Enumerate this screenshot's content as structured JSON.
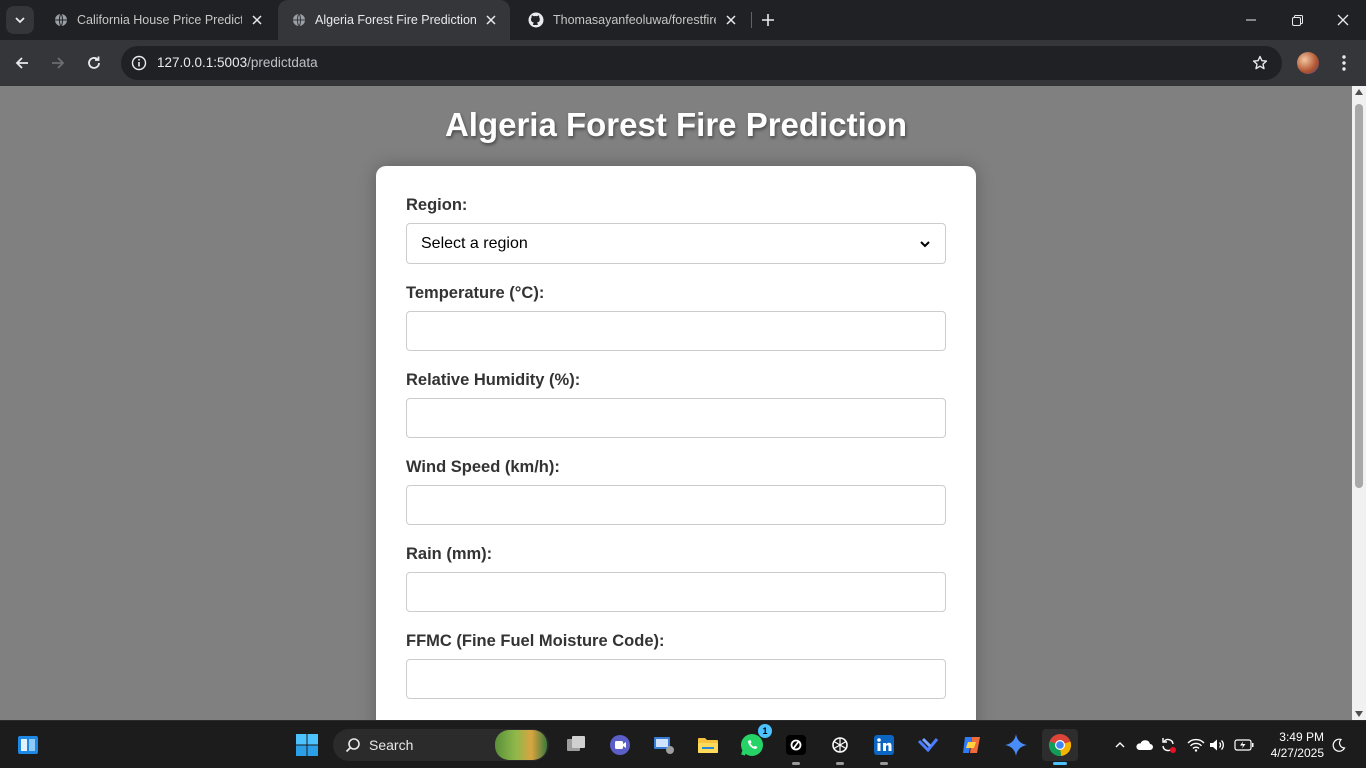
{
  "browser": {
    "tabs": [
      {
        "title": "California House Price Predictio",
        "active": false
      },
      {
        "title": "Algeria Forest Fire Prediction",
        "active": true
      },
      {
        "title": "Thomasayanfeoluwa/forestfireP",
        "active": false
      }
    ],
    "url_host": "127.0.0.1:5003",
    "url_path": "/predictdata"
  },
  "page": {
    "title": "Algeria Forest Fire Prediction",
    "form": {
      "region_label": "Region:",
      "region_selected": "Select a region",
      "temperature_label": "Temperature (°C):",
      "temperature_value": "",
      "humidity_label": "Relative Humidity (%):",
      "humidity_value": "",
      "wind_label": "Wind Speed (km/h):",
      "wind_value": "",
      "rain_label": "Rain (mm):",
      "rain_value": "",
      "ffmc_label": "FFMC (Fine Fuel Moisture Code):",
      "ffmc_value": ""
    }
  },
  "taskbar": {
    "search_label": "Search",
    "whatsapp_badge": "1",
    "time": "3:49 PM",
    "date": "4/27/2025"
  },
  "colors": {
    "page_background": "#808080",
    "card_background": "#ffffff",
    "label_text": "#333333",
    "chrome_dark": "#202124",
    "chrome_toolbar": "#35363a"
  }
}
